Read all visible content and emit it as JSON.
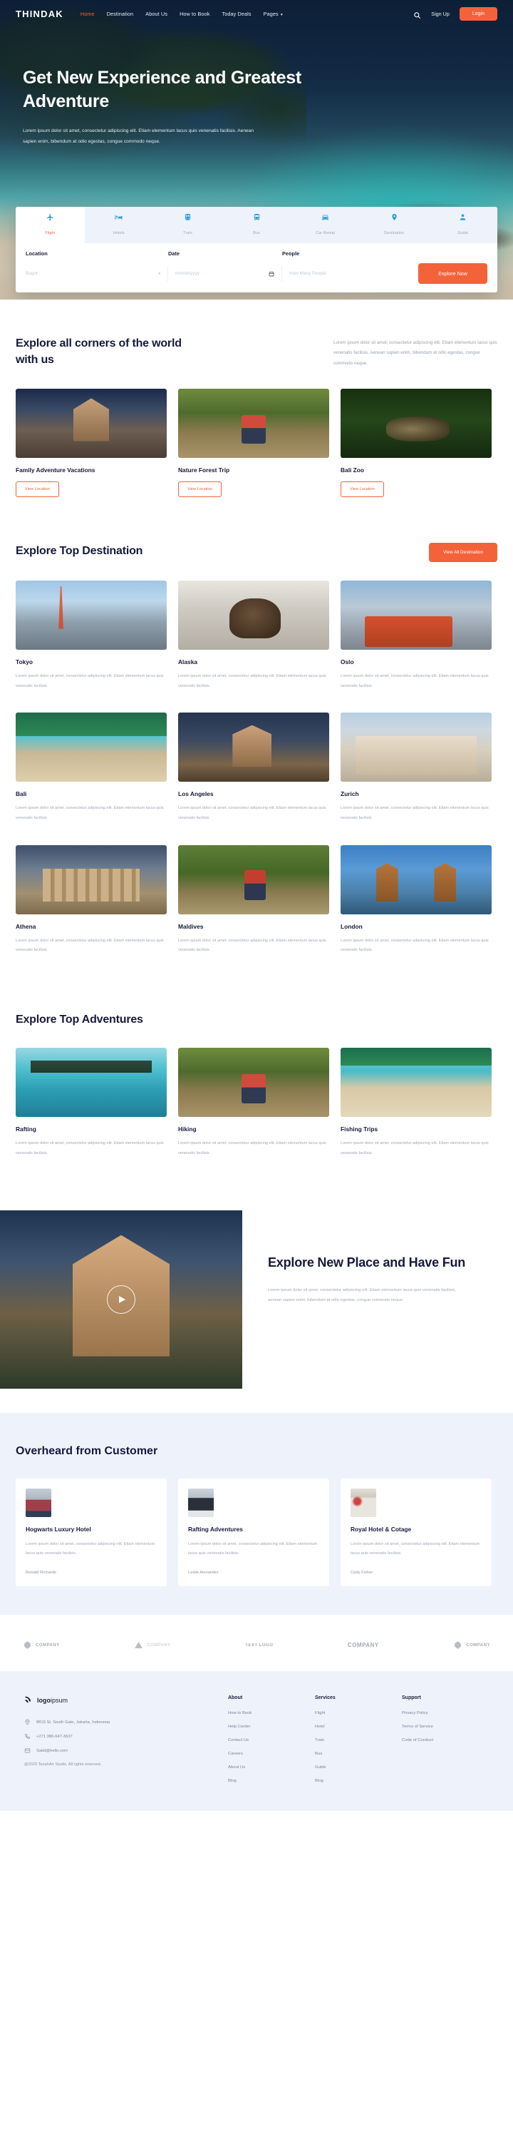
{
  "nav": {
    "brand": "THINDAK",
    "links": [
      {
        "label": "Home",
        "active": true
      },
      {
        "label": "Destination",
        "active": false
      },
      {
        "label": "About Us",
        "active": false
      },
      {
        "label": "How to Book",
        "active": false
      },
      {
        "label": "Today Deals",
        "active": false
      },
      {
        "label": "Pages",
        "active": false,
        "caret": "▾"
      }
    ],
    "search_icon": "search-icon",
    "signup": "Sign Up",
    "login": "Login"
  },
  "hero": {
    "title": "Get New Experience and Greatest Adventure",
    "subtitle": "Lorem ipsum dolor sit amet, consectetur adipiscing elit. Etiam elementum lacus quis venenatis facilisis. Aenean sapien enim, bibendum at odio egestas, congue commodo neque."
  },
  "booking": {
    "tabs": [
      {
        "label": "Flight",
        "icon": "plane-icon",
        "active": true
      },
      {
        "label": "Hotels",
        "icon": "bed-icon",
        "active": false
      },
      {
        "label": "Train",
        "icon": "train-icon",
        "active": false
      },
      {
        "label": "Bus",
        "icon": "bus-icon",
        "active": false
      },
      {
        "label": "Car Rental",
        "icon": "car-icon",
        "active": false
      },
      {
        "label": "Destination",
        "icon": "pin-icon",
        "active": false
      },
      {
        "label": "Guide",
        "icon": "person-icon",
        "active": false
      }
    ],
    "labels": {
      "location": "Location",
      "date": "Date",
      "people": "People"
    },
    "placeholders": {
      "location": "Bogor",
      "date": "mm/dd/yyyy",
      "people": "How Many People"
    },
    "submit": "Explore Now"
  },
  "corners": {
    "title": "Explore all corners of the world with us",
    "desc": "Lorem ipsum dolor sit amet, consectetur adipiscing elit. Etiam elementum lacus quis venenatis facilisis. Aenean sapien enim, bibendum at odio egestas, congue commodo neque.",
    "cards": [
      {
        "title": "Family Adventure Vacations",
        "button": "View Location",
        "img": "im-church"
      },
      {
        "title": "Nature Forest Trip",
        "button": "View Location",
        "img": "im-hike"
      },
      {
        "title": "Bali Zoo",
        "button": "View Location",
        "img": "im-zoo"
      }
    ]
  },
  "destinations": {
    "title": "Explore Top Destination",
    "button": "View All Destination",
    "body": "Lorem ipsum dolor sit amet, consectetur adipiscing elit. Etiam elementum lacus quis venenatis facilisis.",
    "items": [
      {
        "title": "Tokyo",
        "img": "im-tokyo"
      },
      {
        "title": "Alaska",
        "img": "im-alaska"
      },
      {
        "title": "Oslo",
        "img": "im-oslo"
      },
      {
        "title": "Bali",
        "img": "im-bali"
      },
      {
        "title": "Los Angeles",
        "img": "im-la"
      },
      {
        "title": "Zurich",
        "img": "im-zurich"
      },
      {
        "title": "Athena",
        "img": "im-athena"
      },
      {
        "title": "Maldives",
        "img": "im-maldives"
      },
      {
        "title": "London",
        "img": "im-london"
      }
    ]
  },
  "adventures": {
    "title": "Explore Top Adventures",
    "body": "Lorem ipsum dolor sit amet, consectetur adipiscing elit. Etiam elementum lacus quis venenatis facilisis.",
    "items": [
      {
        "title": "Rafting",
        "img": "im-raft"
      },
      {
        "title": "Hiking",
        "img": "im-hike"
      },
      {
        "title": "Fishing Trips",
        "img": "im-fish"
      }
    ]
  },
  "newplace": {
    "title": "Explore New Place and Have Fun",
    "desc": "Lorem ipsum dolor sit amet, consectetur adipiscing elit. Etiam elementum lacus quis venenatis facilisis, aenean sapien enim, bibendum at odio egestas, congue commodo neque.",
    "play_icon": "play-icon"
  },
  "testimonials": {
    "title": "Overheard from Customer",
    "items": [
      {
        "title": "Hogwarts Luxury Hotel",
        "text": "Lorem ipsum dolor sit amet, consectetur adipiscing elit. Etiam elementum lacus quis venenatis facilisis.",
        "name": "Ronald Richards",
        "avatar": "av1"
      },
      {
        "title": "Rafting Adventures",
        "text": "Lorem ipsum dolor sit amet, consectetur adipiscing elit. Etiam elementum lacus quis venenatis facilisis.",
        "name": "Leslie Alexander",
        "avatar": "av2"
      },
      {
        "title": "Royal Hotel & Cotage",
        "text": "Lorem ipsum dolor sit amet, consectetur adipiscing elit. Etiam elementum lacus quis venenatis facilisis.",
        "name": "Cody Fisher",
        "avatar": "av3"
      }
    ]
  },
  "logos": [
    {
      "name": "COMPANY",
      "style": "bold"
    },
    {
      "name": "COMPANY",
      "style": "light"
    },
    {
      "name": "TEXT LOGO",
      "style": "bold"
    },
    {
      "name": "COMPANY",
      "style": "bold"
    },
    {
      "name": "COMPANY",
      "style": "bold"
    }
  ],
  "footer": {
    "logo": {
      "bold": "logo",
      "rest": "ipsum"
    },
    "address": "8819 St. South Gate, Jakarta, Indonesia",
    "phone": "+271 386-647-3637",
    "email": "Saitd@hello.com",
    "copyright": "@2020 TanahAir Studio. All rights reserved.",
    "columns": [
      {
        "heading": "About",
        "links": [
          "How to Book",
          "Help Center",
          "Contact Us",
          "Careers",
          "About Us",
          "Blog"
        ]
      },
      {
        "heading": "Services",
        "links": [
          "Flight",
          "Hotel",
          "Train",
          "Bus",
          "Guide",
          "Blog"
        ]
      },
      {
        "heading": "Support",
        "links": [
          "Privacy Policy",
          "Terms of Service",
          "Code of Conduct"
        ]
      }
    ]
  },
  "colors": {
    "accent": "#f4623a",
    "dark": "#17193b",
    "icon_blue": "#2d9cdb",
    "panel": "#eef2fb"
  }
}
